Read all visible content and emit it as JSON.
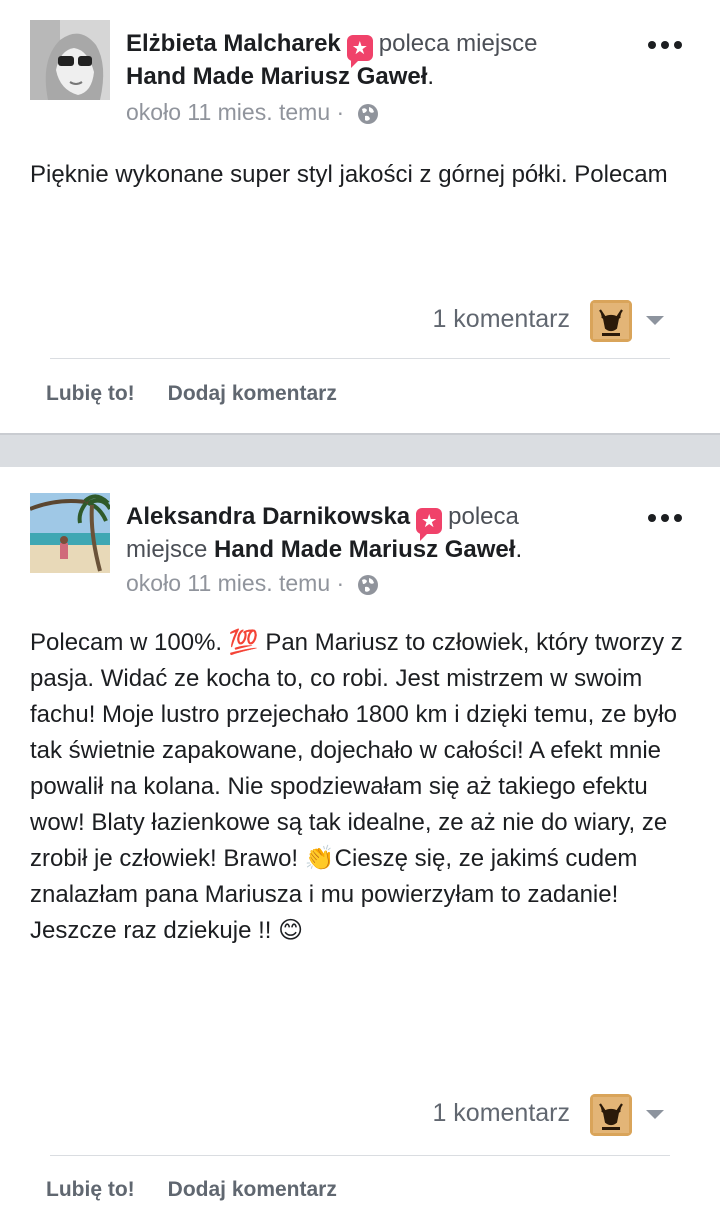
{
  "posts": [
    {
      "author": "Elżbieta Malcharek",
      "action_text": "poleca miejsce",
      "page_name": "Hand Made Mariusz Gaweł",
      "page_suffix": ".",
      "time": "około 11 mies. temu",
      "separator": "·",
      "body": "Pięknie wykonane super styl jakości z górnej półki. Polecam",
      "comment_count": "1 komentarz",
      "like_label": "Lubię to!",
      "comment_label": "Dodaj komentarz"
    },
    {
      "author": "Aleksandra Darnikowska",
      "action_text": "poleca",
      "action_text_2": "miejsce",
      "page_name": "Hand Made Mariusz Gaweł",
      "page_suffix": ".",
      "time": "około 11 mies. temu",
      "separator": "·",
      "body_p1": "Polecam w 100%. ",
      "emoji_100": "💯",
      "body_p2": " Pan Mariusz to człowiek, który tworzy z pasja. Widać ze kocha to, co robi. Jest mistrzem w swoim fachu! Moje lustro przejechało 1800 km i dzięki temu, ze było tak świetnie zapakowane, dojechało w całości! A efekt mnie powalił na kolana. Nie spodziewałam się aż takiego efektu wow! Blaty łazienkowe są tak idealne, ze aż nie do wiary, ze zrobił je człowiek! Brawo! ",
      "emoji_clap": "👏",
      "body_p3": "Cieszę się, ze jakimś cudem znalazłam pana Mariusza i mu powierzyłam to zadanie! Jeszcze raz dziekuje !! ",
      "emoji_smile": "😊",
      "comment_count": "1 komentarz",
      "like_label": "Lubię to!",
      "comment_label": "Dodaj komentarz"
    }
  ],
  "colors": {
    "recommend_badge": "#f0426a",
    "separator_bg": "#dadde1",
    "meta_gray": "#90949c",
    "action_gray": "#606770"
  },
  "icons": {
    "recommend": "recommend-badge-icon",
    "globe": "globe-icon",
    "more": "more-horizontal-icon",
    "caret": "caret-down-icon"
  }
}
